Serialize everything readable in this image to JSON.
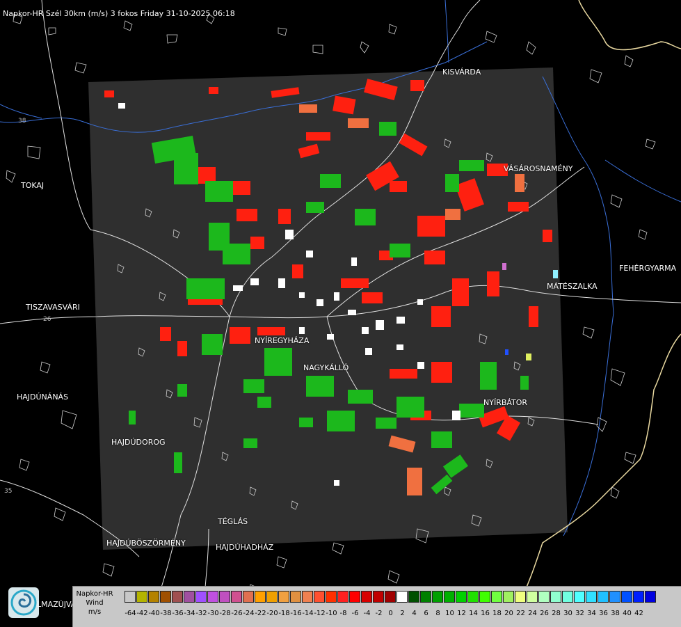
{
  "header": {
    "title": "Napkor-HR Szél 30km (m/s) 3 fokos Friday 31-10-2025 06:18"
  },
  "cities": [
    {
      "id": "kisvarda",
      "label": "KISVÁRDA"
    },
    {
      "id": "tokaj",
      "label": "TOKAJ"
    },
    {
      "id": "vasarosnameny",
      "label": "VÁSÁROSNAMÉNY"
    },
    {
      "id": "fehergyarmat",
      "label": "FEHÉRGYARMA"
    },
    {
      "id": "mateszalka",
      "label": "MÁTÉSZALKA"
    },
    {
      "id": "tiszavasvari",
      "label": "TISZAVASVÁRI"
    },
    {
      "id": "nyiregyhaza",
      "label": "NYÍREGYHÁZA"
    },
    {
      "id": "nagykallo",
      "label": "NAGYKÁLLÓ"
    },
    {
      "id": "hajdunanas",
      "label": "HAJDÚNÁNÁS"
    },
    {
      "id": "nyirbator",
      "label": "NYÍRBÁTOR"
    },
    {
      "id": "hajdudorog",
      "label": "HAJDÚDOROG"
    },
    {
      "id": "teglas",
      "label": "TÉGLÁS"
    },
    {
      "id": "hajduboszormeny",
      "label": "HAJDÚBÖSZÖRMÉNY"
    },
    {
      "id": "hajduhadhaz",
      "label": "HAJDÚHADHÁZ"
    },
    {
      "id": "almazujvaros",
      "label": "LMAZÚJVÁR"
    }
  ],
  "road_labels": [
    "26",
    "38",
    "35"
  ],
  "legend": {
    "product": "Napkor-HR",
    "quantity": "Wind",
    "unit": "m/s",
    "colors": [
      "#c8c8c8",
      "#b4b400",
      "#b48200",
      "#a05000",
      "#a05050",
      "#a050a0",
      "#a050ff",
      "#c050e0",
      "#c050c0",
      "#d05090",
      "#e07050",
      "#ffa000",
      "#f0a000",
      "#f0a040",
      "#e09040",
      "#f08050",
      "#ff5030",
      "#ff3000",
      "#ff2020",
      "#ff0000",
      "#d80000",
      "#c00000",
      "#a00000",
      "#ffffff",
      "#005000",
      "#008000",
      "#00a000",
      "#00b000",
      "#00d000",
      "#20e000",
      "#40ff00",
      "#70ff40",
      "#a0f060",
      "#f0ff80",
      "#d0ffa0",
      "#b0ffc0",
      "#90ffd0",
      "#70ffe0",
      "#50ffff",
      "#30e0ff",
      "#20c0ff",
      "#2090ff",
      "#0050ff",
      "#0020ff",
      "#0000e0"
    ],
    "ticks": [
      "-64",
      "-42",
      "-40",
      "-38",
      "-36",
      "-34",
      "-32",
      "-30",
      "-28",
      "-26",
      "-24",
      "-22",
      "-20",
      "-18",
      "-16",
      "-14",
      "-12",
      "-10",
      "-8",
      "-6",
      "-4",
      "-2",
      "0",
      "2",
      "4",
      "6",
      "8",
      "10",
      "12",
      "14",
      "16",
      "18",
      "20",
      "22",
      "24",
      "26",
      "28",
      "30",
      "32",
      "34",
      "36",
      "38",
      "40",
      "42"
    ]
  }
}
